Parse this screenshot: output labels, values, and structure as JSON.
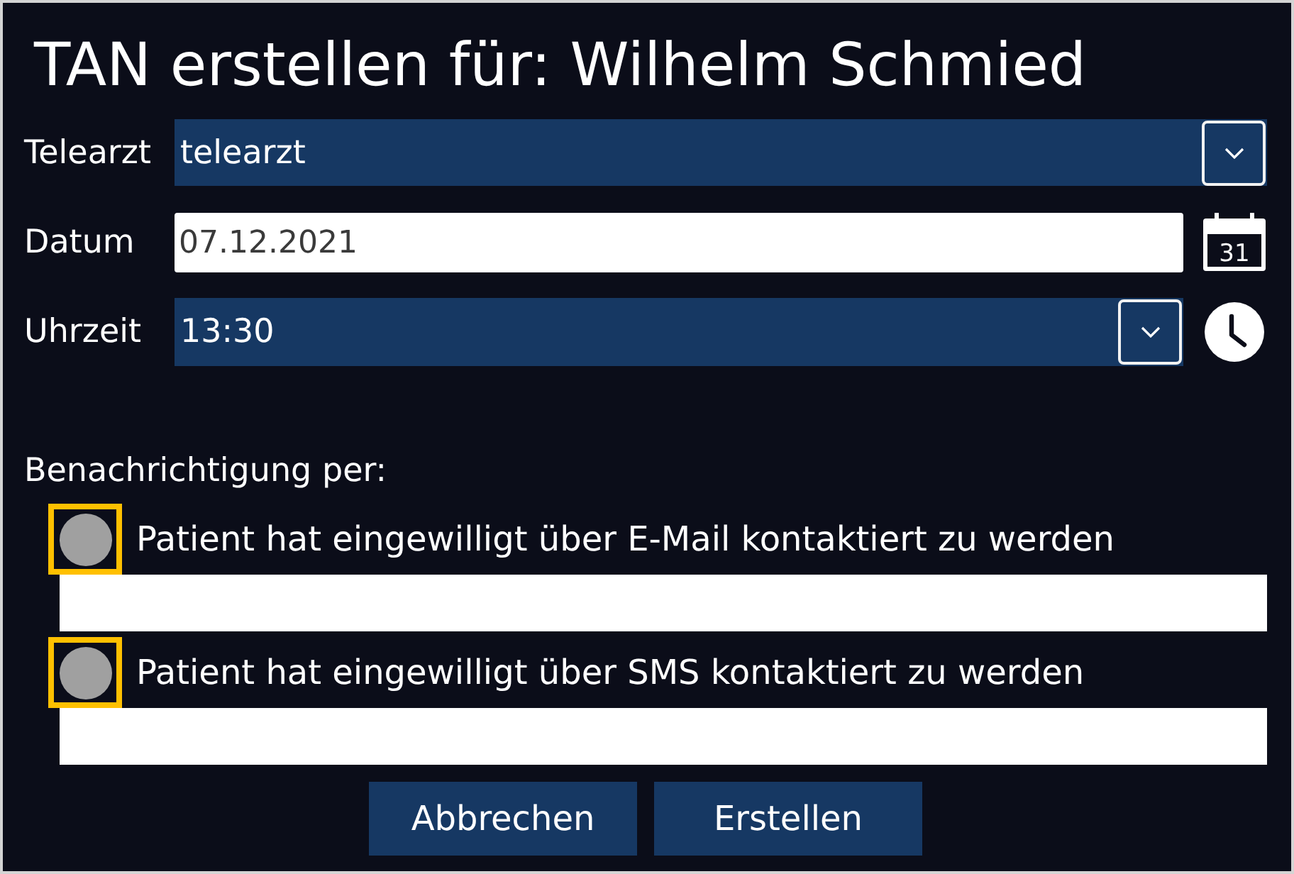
{
  "dialog": {
    "title": "TAN erstellen für: Wilhelm Schmied"
  },
  "fields": [
    {
      "kind": "dropdown",
      "label": "Telearzt",
      "value": "telearzt"
    },
    {
      "kind": "date",
      "label": "Datum",
      "value": "07.12.2021",
      "calendar_day": "31"
    },
    {
      "kind": "time",
      "label": "Uhrzeit",
      "value": "13:30"
    }
  ],
  "notification": {
    "label": "Benachrichtigung per:",
    "options": [
      {
        "text": "Patient hat eingewilligt über E-Mail kontaktiert zu werden",
        "checked": false,
        "focused": true
      },
      {
        "text": "Patient hat eingewilligt über SMS kontaktiert zu werden",
        "checked": false,
        "focused": true
      }
    ]
  },
  "buttons": [
    {
      "label": "Abbrechen"
    },
    {
      "label": "Erstellen"
    }
  ]
}
